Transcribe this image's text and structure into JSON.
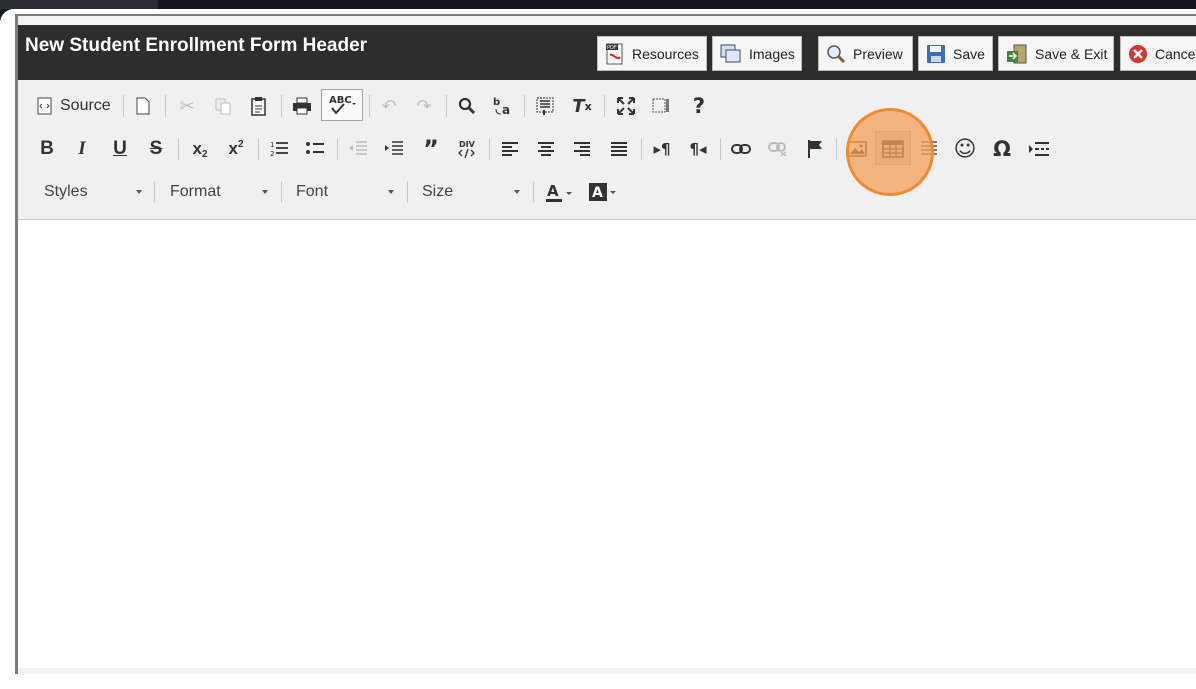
{
  "title": "New Student Enrollment Form Header",
  "header_buttons": {
    "resources": "Resources",
    "images": "Images",
    "preview": "Preview",
    "save": "Save",
    "save_exit": "Save & Exit",
    "cancel": "Cance"
  },
  "toolbar": {
    "source": "Source",
    "styles": "Styles",
    "format": "Format",
    "font": "Font",
    "size": "Size"
  },
  "colors": {
    "titlebar": "#2d2d2d",
    "highlight": "#f08a30"
  }
}
